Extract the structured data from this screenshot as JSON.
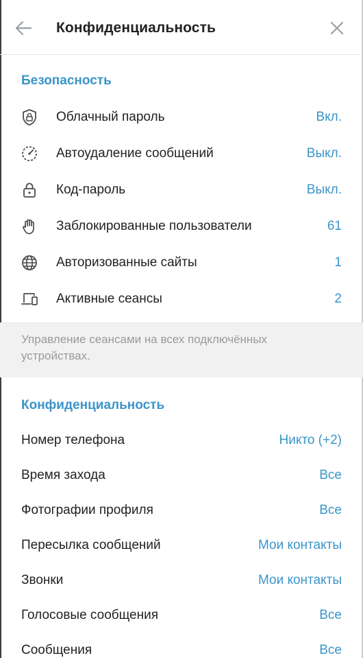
{
  "header": {
    "title": "Конфиденциальность"
  },
  "security": {
    "title": "Безопасность",
    "items": [
      {
        "icon": "shield-lock-icon",
        "label": "Облачный пароль",
        "value": "Вкл."
      },
      {
        "icon": "timer-icon",
        "label": "Автоудаление сообщений",
        "value": "Выкл."
      },
      {
        "icon": "lock-icon",
        "label": "Код-пароль",
        "value": "Выкл."
      },
      {
        "icon": "hand-stop-icon",
        "label": "Заблокированные пользователи",
        "value": "61"
      },
      {
        "icon": "globe-icon",
        "label": "Авторизованные сайты",
        "value": "1"
      },
      {
        "icon": "devices-icon",
        "label": "Активные сеансы",
        "value": "2"
      }
    ],
    "note": "Управление сеансами на всех подключённых устройствах."
  },
  "privacy": {
    "title": "Конфиденциальность",
    "items": [
      {
        "label": "Номер телефона",
        "value": "Никто (+2)"
      },
      {
        "label": "Время захода",
        "value": "Все"
      },
      {
        "label": "Фотографии профиля",
        "value": "Все"
      },
      {
        "label": "Пересылка сообщений",
        "value": "Мои контакты"
      },
      {
        "label": "Звонки",
        "value": "Мои контакты"
      },
      {
        "label": "Голосовые сообщения",
        "value": "Все"
      },
      {
        "label": "Сообщения",
        "value": "Все"
      }
    ]
  },
  "colors": {
    "accent": "#3a95c9",
    "text": "#222222",
    "muted": "#9a9a9a",
    "note_bg": "#f1f1f1"
  }
}
